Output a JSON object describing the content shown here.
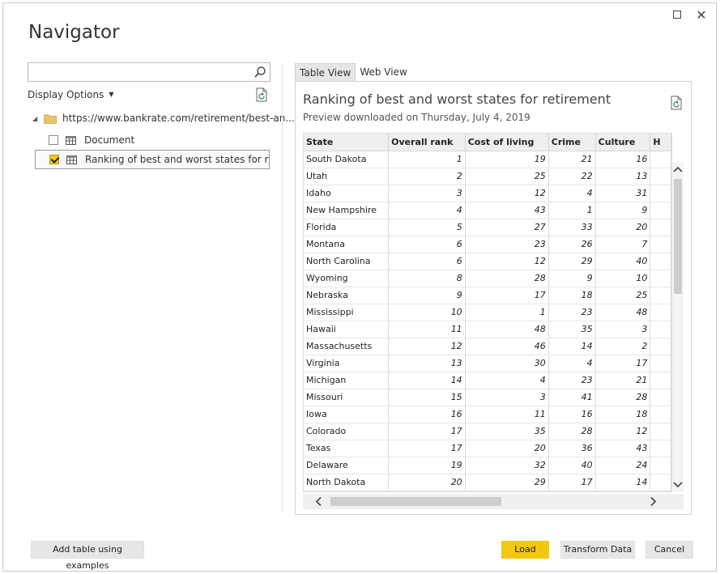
{
  "window": {
    "title": "Navigator"
  },
  "left": {
    "search": {
      "value": "",
      "placeholder": ""
    },
    "display_options_label": "Display Options",
    "tree": {
      "root_label": "https://www.bankrate.com/retirement/best-an...",
      "items": [
        {
          "label": "Document",
          "checked": false
        },
        {
          "label": "Ranking of best and worst states for retire...",
          "checked": true
        }
      ]
    }
  },
  "right": {
    "tabs": [
      {
        "label": "Table View",
        "active": true
      },
      {
        "label": "Web View",
        "active": false
      }
    ],
    "preview_title": "Ranking of best and worst states for retirement",
    "preview_subtitle": "Preview downloaded on Thursday, July 4, 2019",
    "table": {
      "columns": [
        "State",
        "Overall rank",
        "Cost of living",
        "Crime",
        "Culture",
        "H"
      ],
      "rows": [
        [
          "South Dakota",
          "1",
          "19",
          "21",
          "16"
        ],
        [
          "Utah",
          "2",
          "25",
          "22",
          "13"
        ],
        [
          "Idaho",
          "3",
          "12",
          "4",
          "31"
        ],
        [
          "New Hampshire",
          "4",
          "43",
          "1",
          "9"
        ],
        [
          "Florida",
          "5",
          "27",
          "33",
          "20"
        ],
        [
          "Montana",
          "6",
          "23",
          "26",
          "7"
        ],
        [
          "North Carolina",
          "6",
          "12",
          "29",
          "40"
        ],
        [
          "Wyoming",
          "8",
          "28",
          "9",
          "10"
        ],
        [
          "Nebraska",
          "9",
          "17",
          "18",
          "25"
        ],
        [
          "Mississippi",
          "10",
          "1",
          "23",
          "48"
        ],
        [
          "Hawaii",
          "11",
          "48",
          "35",
          "3"
        ],
        [
          "Massachusetts",
          "12",
          "46",
          "14",
          "2"
        ],
        [
          "Virginia",
          "13",
          "30",
          "4",
          "17"
        ],
        [
          "Michigan",
          "14",
          "4",
          "23",
          "21"
        ],
        [
          "Missouri",
          "15",
          "3",
          "41",
          "28"
        ],
        [
          "Iowa",
          "16",
          "11",
          "16",
          "18"
        ],
        [
          "Colorado",
          "17",
          "35",
          "28",
          "12"
        ],
        [
          "Texas",
          "17",
          "20",
          "36",
          "43"
        ],
        [
          "Delaware",
          "19",
          "32",
          "40",
          "24"
        ],
        [
          "North Dakota",
          "20",
          "29",
          "17",
          "14"
        ],
        [
          "",
          "",
          "",
          "",
          ""
        ]
      ]
    }
  },
  "footer": {
    "add_table_label": "Add table using examples",
    "load_label": "Load",
    "transform_label": "Transform Data",
    "cancel_label": "Cancel"
  },
  "colors": {
    "accent": "#f2c811",
    "button_bg": "#e6e6e6"
  }
}
